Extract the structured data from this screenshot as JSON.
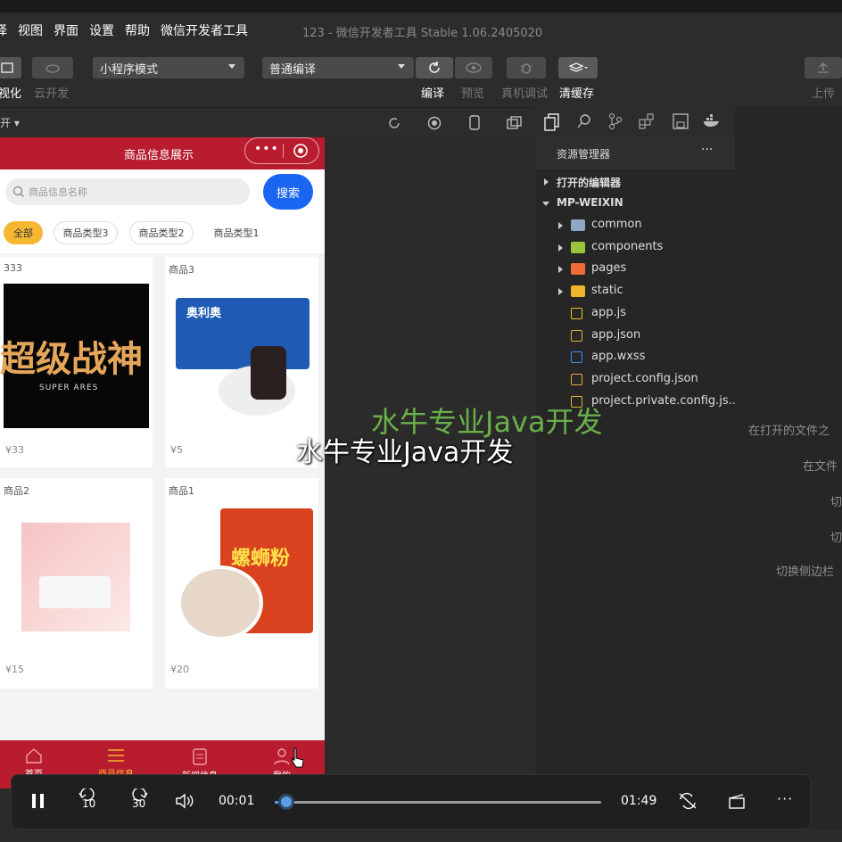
{
  "menubar": {
    "items": [
      "择",
      "视图",
      "界面",
      "设置",
      "帮助",
      "微信开发者工具"
    ]
  },
  "window_title": "123 - 微信开发者工具 Stable 1.06.2405020",
  "toolbar": {
    "left_label": "视化",
    "cloud_label": "云开发",
    "mode_select": "小程序模式",
    "compile_select": "普通编译",
    "compile_label": "编译",
    "preview_label": "预览",
    "device_debug_label": "真机调试",
    "clear_cache_label": "清缓存",
    "upload_label": "上传",
    "row2_left": "开 ▾"
  },
  "phone": {
    "nav_title": "商品信息展示",
    "search_placeholder": "商品信息名称",
    "search_button": "搜索",
    "chips": [
      "全部",
      "商品类型3",
      "商品类型2",
      "商品类型1"
    ],
    "products": [
      {
        "name": "333",
        "price": "¥33"
      },
      {
        "name": "商品3",
        "price": "¥5"
      },
      {
        "name": "商品2",
        "price": "¥15"
      },
      {
        "name": "商品1",
        "price": "¥20"
      }
    ],
    "card_image_text": {
      "banner1": "超级战神",
      "banner1_sub": "SUPER ARES",
      "snail": "螺蛳粉",
      "oreo": "奥利奥"
    },
    "tabbar": [
      "首页",
      "商品信息",
      "新闻信息",
      "我的"
    ]
  },
  "explorer": {
    "title": "资源管理器",
    "more": "···",
    "open_editors": "打开的编辑器",
    "project": "MP-WEIXIN",
    "files": [
      {
        "name": "common",
        "icon": "folder-icon",
        "color": "#8fa6c4",
        "folder": true
      },
      {
        "name": "components",
        "icon": "folder-components-icon",
        "color": "#9bc53d",
        "folder": true
      },
      {
        "name": "pages",
        "icon": "folder-pages-icon",
        "color": "#ef6c39",
        "folder": true
      },
      {
        "name": "static",
        "icon": "folder-static-icon",
        "color": "#f0b429",
        "folder": true
      },
      {
        "name": "app.js",
        "icon": "js-file-icon",
        "color": "#f0c419",
        "folder": false
      },
      {
        "name": "app.json",
        "icon": "json-file-icon",
        "color": "#e2b23c",
        "folder": false
      },
      {
        "name": "app.wxss",
        "icon": "css-file-icon",
        "color": "#3e8ef7",
        "folder": false
      },
      {
        "name": "project.config.json",
        "icon": "json-file-icon",
        "color": "#e2b23c",
        "folder": false
      },
      {
        "name": "project.private.config.js...",
        "icon": "json-file-icon",
        "color": "#e2b23c",
        "folder": false
      }
    ]
  },
  "right_panel": [
    "在打开的文件之",
    "在文件",
    "切",
    "切",
    "切换侧边栏"
  ],
  "watermark": {
    "green": "水牛专业Java开发",
    "white": "水牛专业Java开发"
  },
  "player": {
    "current_time": "00:01",
    "total_time": "01:49",
    "progress": 0.01,
    "skip_back": "10",
    "skip_forward": "30"
  },
  "colors": {
    "accent_red": "#b81c2e",
    "search_blue": "#1a66f0",
    "chip_active": "#f5b731",
    "progress_blue": "#5aa0e8"
  }
}
